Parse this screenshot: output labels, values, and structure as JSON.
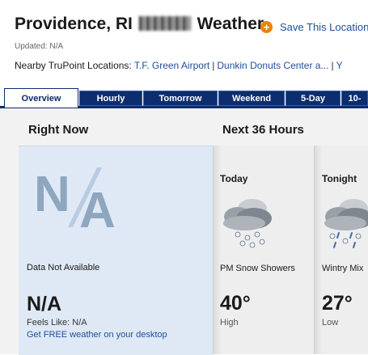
{
  "header": {
    "title_prefix": "Providence, RI",
    "title_suffix": "Weather",
    "save_label": "Save This Location",
    "updated": "Updated: N/A"
  },
  "nearby": {
    "label": "Nearby TruPoint Locations:",
    "links": [
      "T.F. Green Airport",
      "Dunkin Donuts Center a...",
      "Y"
    ]
  },
  "tabs": [
    {
      "label": "Overview",
      "active": true
    },
    {
      "label": "Hourly"
    },
    {
      "label": "Tomorrow"
    },
    {
      "label": "Weekend"
    },
    {
      "label": "5-Day"
    },
    {
      "label": "10-"
    }
  ],
  "right_now": {
    "heading": "Right Now",
    "icon_text": "N/A",
    "condition": "Data Not Available",
    "temp": "N/A",
    "feels_like": "Feels Like: N/A",
    "desktop_link": "Get FREE weather on your desktop"
  },
  "next36": {
    "heading": "Next 36 Hours",
    "periods": [
      {
        "name": "Today",
        "condition": "PM Snow Showers",
        "temp": "40°",
        "temp_label": "High",
        "icon": "snow-showers-icon"
      },
      {
        "name": "Tonight",
        "condition": "Wintry Mix",
        "temp": "27°",
        "temp_label": "Low",
        "icon": "wintry-mix-icon"
      }
    ]
  },
  "colors": {
    "tab_bg": "#0d2e6e",
    "link": "#1f4e9a",
    "save_icon": "#e8840e",
    "right_now_bg": "#dfe9f6"
  }
}
